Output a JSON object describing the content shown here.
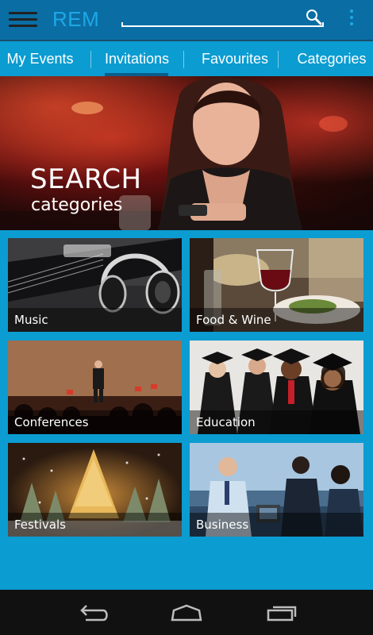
{
  "app": {
    "brand": "REM"
  },
  "search": {
    "value": "",
    "placeholder": ""
  },
  "tabs": [
    {
      "label": "My Events",
      "active": false
    },
    {
      "label": "Invitations",
      "active": true
    },
    {
      "label": "Favourites",
      "active": false
    },
    {
      "label": "Categories",
      "active": false
    }
  ],
  "hero": {
    "title": "SEARCH",
    "subtitle": "categories"
  },
  "categories": [
    {
      "label": "Music",
      "icon": "headphones-image"
    },
    {
      "label": "Food & Wine",
      "icon": "wine-glass-image"
    },
    {
      "label": "Conferences",
      "icon": "speaker-stage-image"
    },
    {
      "label": "Education",
      "icon": "graduates-image"
    },
    {
      "label": "Festivals",
      "icon": "christmas-tree-image"
    },
    {
      "label": "Business",
      "icon": "business-meeting-image"
    }
  ],
  "colors": {
    "appbar": "#0a6ea4",
    "accent": "#1ea8e6",
    "background": "#0b9cd1",
    "navbar": "#111111"
  },
  "navbar": {
    "buttons": [
      "back",
      "home",
      "recent-apps"
    ]
  }
}
